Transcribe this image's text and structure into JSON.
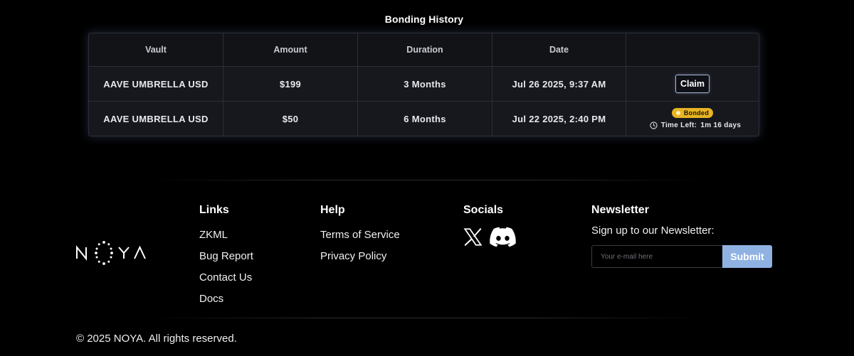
{
  "bonding": {
    "title": "Bonding History",
    "columns": [
      "Vault",
      "Amount",
      "Duration",
      "Date",
      ""
    ],
    "rows": [
      {
        "vault": "AAVE UMBRELLA USD",
        "amount": "$199",
        "duration": "3 Months",
        "date": "Jul 26 2025, 9:37 AM",
        "action_label": "Claim"
      },
      {
        "vault": "AAVE UMBRELLA USD",
        "amount": "$50",
        "duration": "6 Months",
        "date": "Jul 22 2025, 2:40 PM",
        "status_label": "Bonded",
        "time_left_label": "Time Left:",
        "time_left_value": "1m 16 days"
      }
    ]
  },
  "footer": {
    "logo_text": "NOYA",
    "links": {
      "heading": "Links",
      "items": [
        "ZKML",
        "Bug Report",
        "Contact Us",
        "Docs"
      ]
    },
    "help": {
      "heading": "Help",
      "items": [
        "Terms of Service",
        "Privacy Policy"
      ]
    },
    "socials": {
      "heading": "Socials",
      "icons": [
        "x-icon",
        "discord-icon"
      ]
    },
    "newsletter": {
      "heading": "Newsletter",
      "label": "Sign up to our Newsletter:",
      "placeholder": "Your e-mail here",
      "submit_label": "Submit"
    },
    "copyright": "© 2025 NOYA. All rights reserved."
  },
  "colors": {
    "background": "#000000",
    "bonded_badge": "#e8b425",
    "submit_button": "#8fb2e3",
    "claim_border": "#a9bad6"
  }
}
